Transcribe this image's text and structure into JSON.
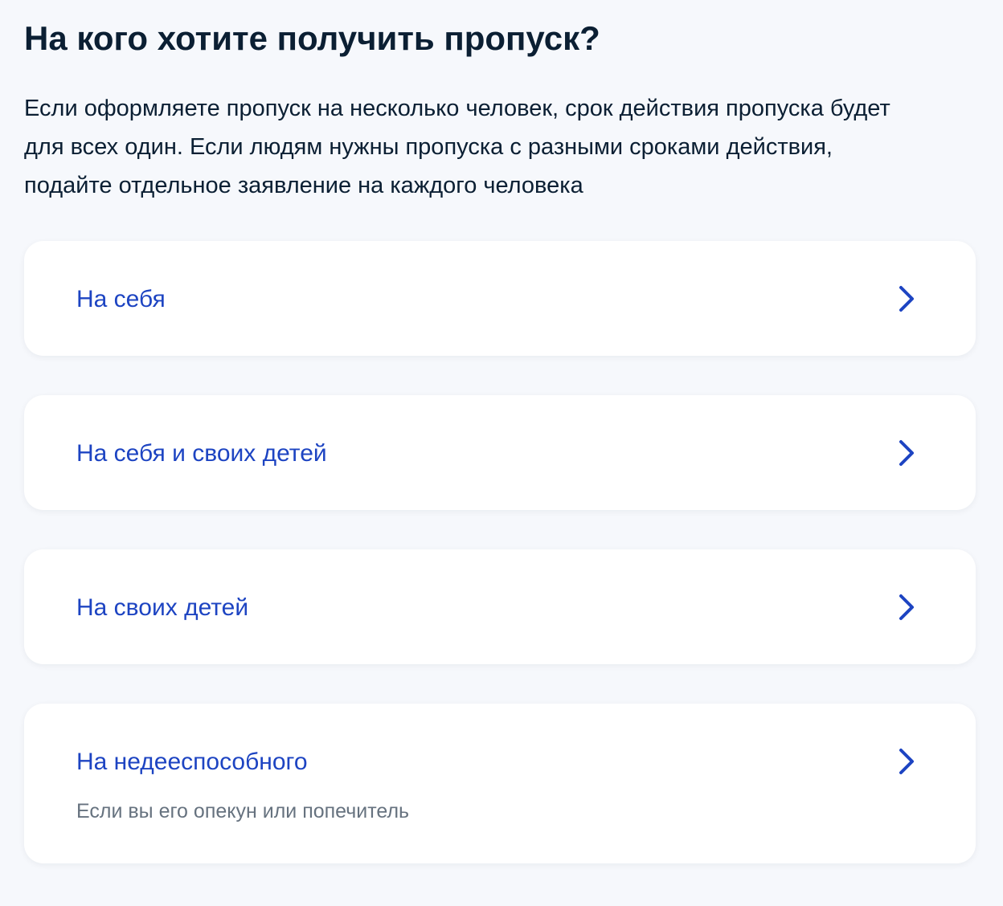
{
  "page": {
    "title": "На кого хотите получить пропуск?",
    "description": "Если оформляете пропуск на несколько человек, срок действия пропуска будет для всех один. Если людям нужны пропуска с разными сроками действия, подайте отдельное заявление на каждого человека"
  },
  "options": [
    {
      "title": "На себя"
    },
    {
      "title": "На себя и своих детей"
    },
    {
      "title": "На своих детей"
    },
    {
      "title": "На недееспособного",
      "subtitle": "Если вы его опекун или попечитель"
    }
  ],
  "colors": {
    "background": "#f6f8fc",
    "card": "#ffffff",
    "accent": "#1d44c2",
    "text": "#0b1f33",
    "secondary_text": "#66727f"
  },
  "icons": {
    "option_chevron": "chevron-right-icon"
  }
}
